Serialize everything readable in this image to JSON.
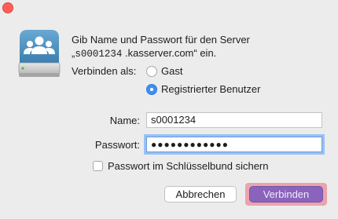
{
  "window": {
    "close": "close"
  },
  "prompt": {
    "line1": "Gib Name und Passwort für den Server",
    "line2_prefix": "„",
    "server": "s0001234",
    "line2_suffix": " .kasserver.com“ ein."
  },
  "connect_as": {
    "label": "Verbinden als:",
    "options": [
      {
        "label": "Gast",
        "selected": false
      },
      {
        "label": "Registrierter Benutzer",
        "selected": true
      }
    ]
  },
  "form": {
    "name_label": "Name:",
    "name_value": "s0001234",
    "password_label": "Passwort:",
    "password_mask": "●●●●●●●●●●●●",
    "keychain_label": "Passwort im Schlüsselbund sichern",
    "keychain_checked": false
  },
  "buttons": {
    "cancel": "Abbrechen",
    "connect": "Verbinden"
  },
  "icons": {
    "drive": "network-server-drive-icon"
  }
}
